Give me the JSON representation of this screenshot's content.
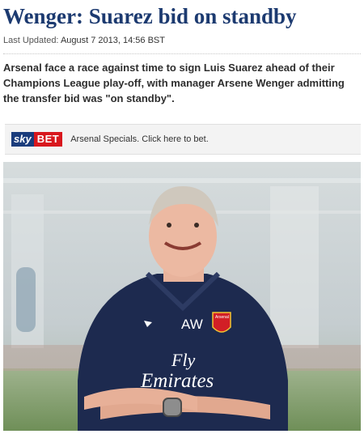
{
  "article": {
    "headline": "Wenger: Suarez bid on standby",
    "updated_label": "Last Updated:",
    "updated_value": "August 7 2013, 14:56 BST",
    "summary": "Arsenal face a race against time to sign Luis Suarez ahead of their Champions League play-off, with manager Arsene Wenger admitting the transfer bid was \"on standby\"."
  },
  "promo": {
    "brand_sky": "sky",
    "brand_bet": "BET",
    "link_text": "Arsenal Specials. Click here to bet.",
    "colors": {
      "sky_blue": "#1a3c7c",
      "bet_red": "#d8171d"
    }
  },
  "photo": {
    "shirt_initials": "AW",
    "badge_text": "Arsenal",
    "sponsor_line1": "Fly",
    "sponsor_line2": "Emirates"
  },
  "colors": {
    "headline": "#1c3a70",
    "shirt": "#1d2a4f"
  }
}
